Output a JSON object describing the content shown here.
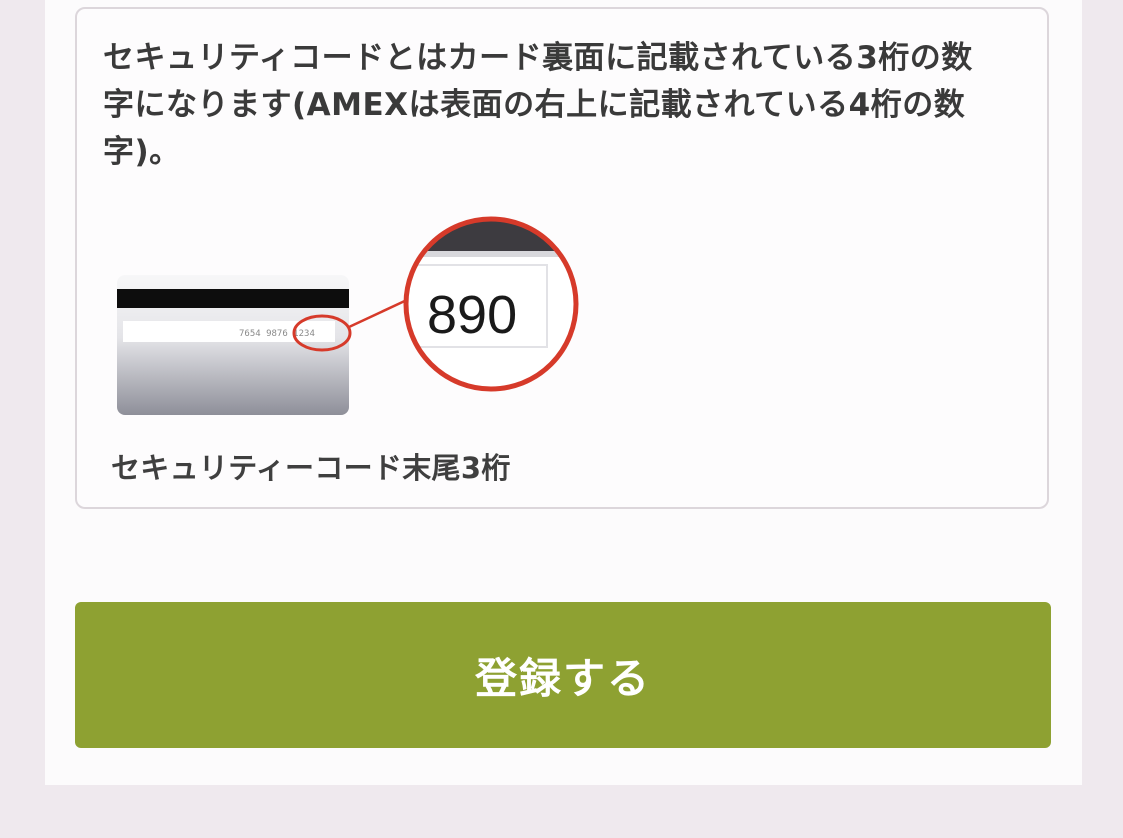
{
  "info": {
    "description": "セキュリティコードとはカード裏面に記載されている3桁の数字になります(AMEXは表面の右上に記載されている4桁の数字)。",
    "example_code": "890",
    "card_strip_digits": "7654 9876 1234",
    "caption": "セキュリティーコード末尾3桁"
  },
  "actions": {
    "register_label": "登録する"
  },
  "colors": {
    "button": "#8ea132",
    "highlight": "#d63a2a",
    "background": "#efe9ee"
  }
}
